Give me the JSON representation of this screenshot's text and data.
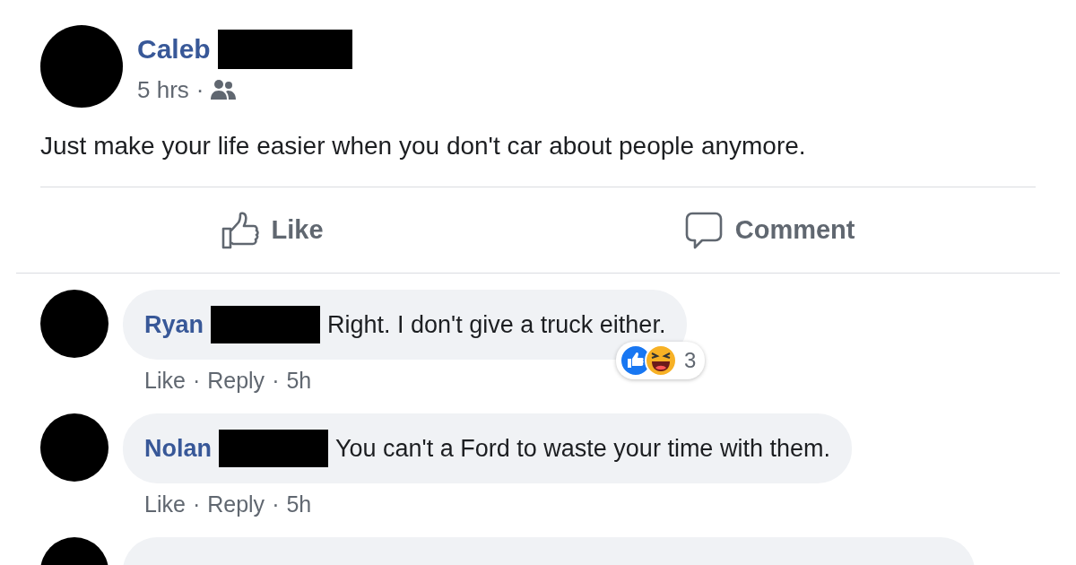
{
  "post": {
    "author": "Caleb",
    "author_redacted": true,
    "time": "5 hrs",
    "separator": "·",
    "text": "Just make your life easier when you don't car about people anymore."
  },
  "actions": [
    {
      "kind": "like",
      "label": "Like"
    },
    {
      "kind": "comment",
      "label": "Comment"
    }
  ],
  "comments": [
    {
      "kind": "full",
      "author": "Ryan",
      "author_redacted": true,
      "text": "Right. I don't give a truck either.",
      "like": "Like",
      "reply": "Reply",
      "time": "5h",
      "reactions": {
        "icons": [
          {
            "kind": "like"
          },
          {
            "kind": "haha"
          }
        ],
        "count": "3"
      }
    },
    {
      "kind": "full",
      "author": "Nolan",
      "author_redacted": true,
      "text": "You can't a Ford to waste your time with them.",
      "like": "Like",
      "reply": "Reply",
      "time": "5h"
    },
    {
      "kind": "cut-off"
    }
  ]
}
